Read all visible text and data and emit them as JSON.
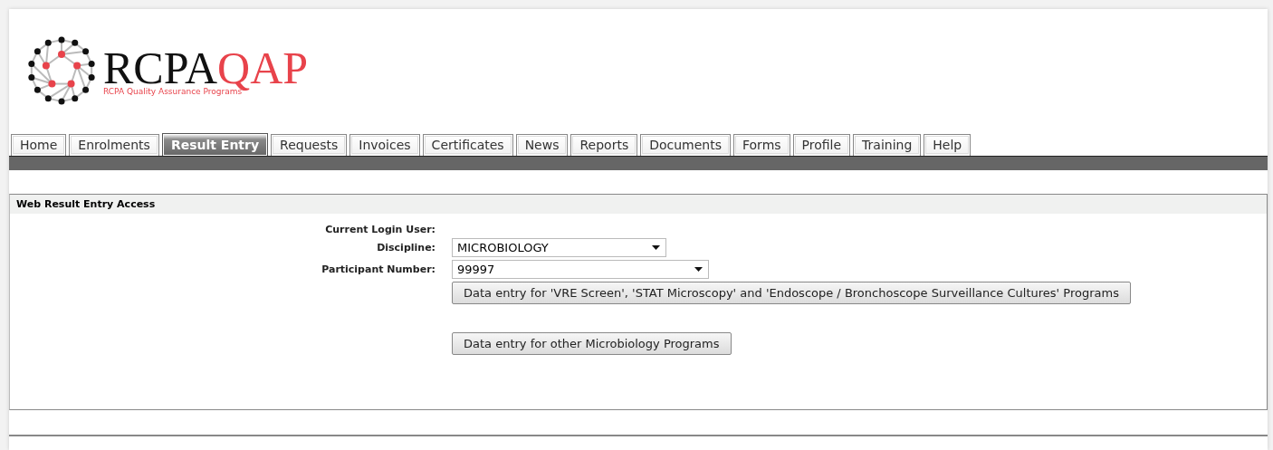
{
  "logo": {
    "name_dark": "RCPA",
    "name_accent": "QAP",
    "tagline": "RCPA Quality Assurance Programs"
  },
  "tabs": [
    {
      "label": "Home",
      "selected": false
    },
    {
      "label": "Enrolments",
      "selected": false
    },
    {
      "label": "Result Entry",
      "selected": true
    },
    {
      "label": "Requests",
      "selected": false
    },
    {
      "label": "Invoices",
      "selected": false
    },
    {
      "label": "Certificates",
      "selected": false
    },
    {
      "label": "News",
      "selected": false
    },
    {
      "label": "Reports",
      "selected": false
    },
    {
      "label": "Documents",
      "selected": false
    },
    {
      "label": "Forms",
      "selected": false
    },
    {
      "label": "Profile",
      "selected": false
    },
    {
      "label": "Training",
      "selected": false
    },
    {
      "label": "Help",
      "selected": false
    }
  ],
  "panel": {
    "title": "Web Result Entry Access",
    "fields": [
      {
        "kind": "text",
        "label": "Current Login User:"
      },
      {
        "kind": "select",
        "label": "Discipline:",
        "value": "MICROBIOLOGY"
      },
      {
        "kind": "select",
        "label": "Participant Number:",
        "value": "99997"
      }
    ],
    "buttons": [
      "Data entry for 'VRE Screen', 'STAT Microscopy' and 'Endoscope / Bronchoscope Surveillance Cultures' Programs",
      "Data entry for other Microbiology Programs"
    ]
  }
}
